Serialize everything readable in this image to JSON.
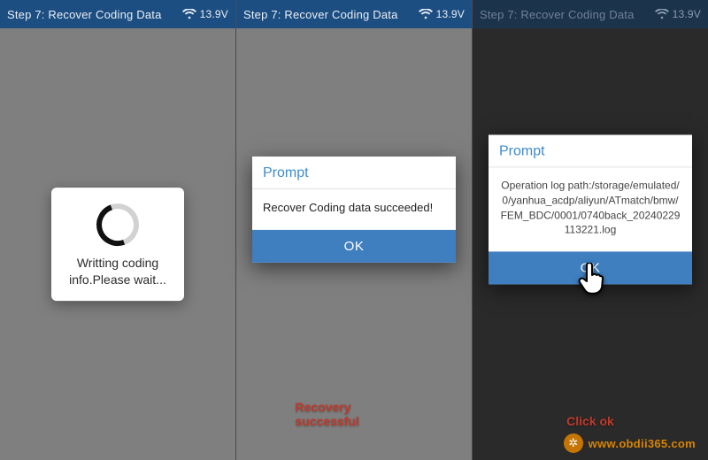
{
  "panels": {
    "p1": {
      "header": {
        "title": "Step 7: Recover Coding Data",
        "voltage": "13.9V"
      },
      "loading_text": "Writting coding info.Please wait..."
    },
    "p2": {
      "header": {
        "title": "Step 7: Recover Coding Data",
        "voltage": "13.9V"
      },
      "dialog": {
        "title": "Prompt",
        "message": "Recover Coding data succeeded!",
        "ok": "OK"
      },
      "caption": "Recovery successful"
    },
    "p3": {
      "header": {
        "title": "Step 7: Recover Coding Data",
        "voltage": "13.9V"
      },
      "dialog": {
        "title": "Prompt",
        "message": "Operation log path:/storage/emulated/0/yanhua_acdp/aliyun/ATmatch/bmw/FEM_BDC/0001/0740back_20240229113221.log",
        "ok": "OK"
      },
      "caption": "Click ok"
    }
  },
  "watermark": "www.obdii365.com",
  "colors": {
    "header_active": "#1d4e82",
    "header_dim": "#1a3552",
    "ok_button": "#3f7fbf",
    "caption": "#c0392b",
    "watermark": "#e08a00"
  }
}
